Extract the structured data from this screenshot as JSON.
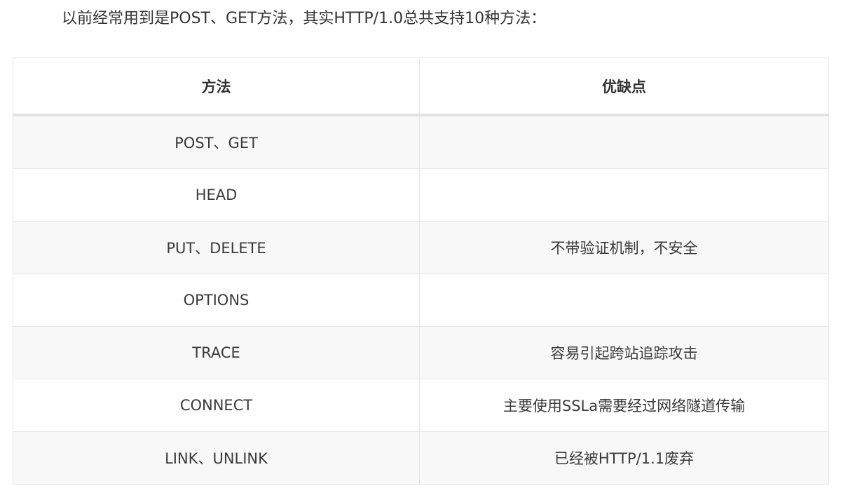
{
  "intro": "以前经常用到是POST、GET方法，其实HTTP/1.0总共支持10种方法：",
  "table": {
    "headers": [
      "方法",
      "优缺点"
    ],
    "rows": [
      {
        "method": "POST、GET",
        "note": ""
      },
      {
        "method": "HEAD",
        "note": ""
      },
      {
        "method": "PUT、DELETE",
        "note": "不带验证机制，不安全"
      },
      {
        "method": "OPTIONS",
        "note": ""
      },
      {
        "method": "TRACE",
        "note": "容易引起跨站追踪攻击"
      },
      {
        "method": "CONNECT",
        "note": "主要使用SSLa需要经过网络隧道传输"
      },
      {
        "method": "LINK、UNLINK",
        "note": "已经被HTTP/1.1废弃"
      }
    ]
  }
}
